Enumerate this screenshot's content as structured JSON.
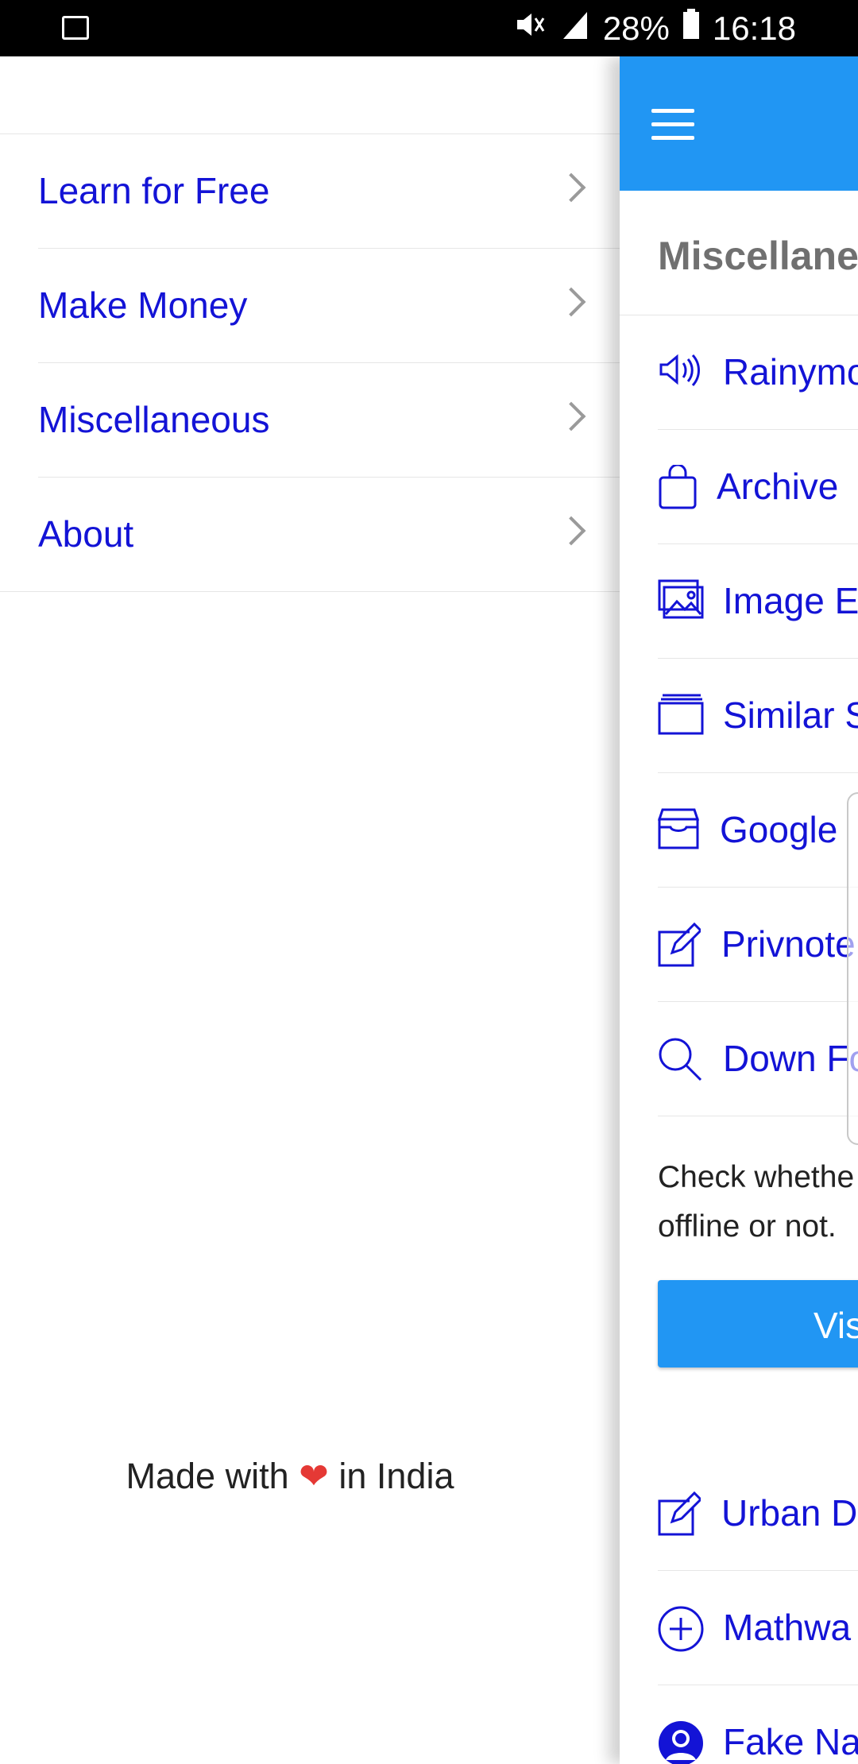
{
  "status_bar": {
    "battery": "28%",
    "time": "16:18",
    "icons": [
      "image-notification-icon",
      "mute-icon",
      "signal-icon",
      "battery-icon"
    ]
  },
  "drawer": {
    "items": [
      {
        "label": "Learn for Free"
      },
      {
        "label": "Make Money"
      },
      {
        "label": "Miscellaneous"
      },
      {
        "label": "About"
      }
    ],
    "footer": {
      "before": "Made with",
      "heart": "❤",
      "after": "in India"
    }
  },
  "panel": {
    "section_title": "Miscellane",
    "rows": [
      {
        "label": "Rainymo",
        "icon": "speaker-icon"
      },
      {
        "label": "Archive",
        "icon": "bag-icon"
      },
      {
        "label": "Image E",
        "icon": "images-icon"
      },
      {
        "label": "Similar S",
        "icon": "windows-icon"
      },
      {
        "label": "Google",
        "icon": "inbox-icon"
      },
      {
        "label": "Privnote",
        "icon": "edit-icon"
      },
      {
        "label": "Down Fo",
        "icon": "search-icon"
      }
    ],
    "description_line1": "Check whethe",
    "description_line2": "offline or not.",
    "visit_button": "Vis",
    "rows_after": [
      {
        "label": "Urban D",
        "icon": "edit-icon"
      },
      {
        "label": "Mathwa",
        "icon": "plus-circle-icon"
      },
      {
        "label": "Fake Na",
        "icon": "person-icon"
      }
    ]
  },
  "colors": {
    "accent": "#2196f3",
    "link": "#1313d6",
    "heart": "#e53935"
  }
}
